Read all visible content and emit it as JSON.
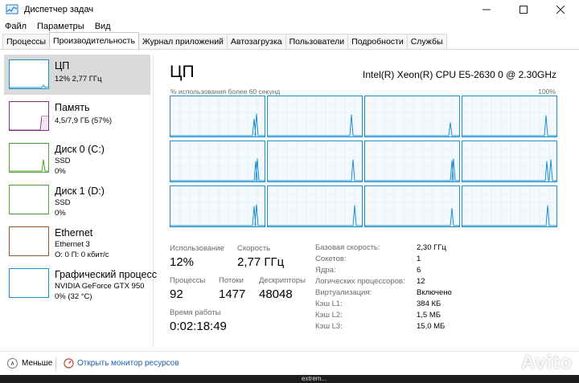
{
  "window": {
    "title": "Диспетчер задач"
  },
  "menu": [
    "Файл",
    "Параметры",
    "Вид"
  ],
  "tabs": [
    "Процессы",
    "Производительность",
    "Журнал приложений",
    "Автозагрузка",
    "Пользователи",
    "Подробности",
    "Службы"
  ],
  "active_tab": "Производительность",
  "sidebar": {
    "items": [
      {
        "name": "ЦП",
        "sub1": "12% 2,77 ГГц",
        "sub2": "",
        "color": "#1a8fd0",
        "selected": true
      },
      {
        "name": "Память",
        "sub1": "4,5/7,9 ГБ (57%)",
        "sub2": "",
        "color": "#8b2c8b",
        "selected": false
      },
      {
        "name": "Диск 0 (C:)",
        "sub1": "SSD",
        "sub2": "0%",
        "color": "#4da32b",
        "selected": false
      },
      {
        "name": "Диск 1 (D:)",
        "sub1": "SSD",
        "sub2": "0%",
        "color": "#4da32b",
        "selected": false
      },
      {
        "name": "Ethernet",
        "sub1": "Ethernet 3",
        "sub2": "О: 0 П: 0 кбит/с",
        "color": "#a0522d",
        "selected": false
      },
      {
        "name": "Графический процесс",
        "sub1": "NVIDIA GeForce GTX 950",
        "sub2": "0% (32 °C)",
        "color": "#1a8fd0",
        "selected": false
      }
    ]
  },
  "main": {
    "title": "ЦП",
    "cpu_model": "Intel(R) Xeon(R) CPU E5-2630 0 @ 2.30GHz",
    "graph_label": "% использования более 60 секунд",
    "graph_max": "100%",
    "cores": 12,
    "stats": {
      "usage_label": "Использование",
      "usage_value": "12%",
      "speed_label": "Скорость",
      "speed_value": "2,77 ГГц",
      "processes_label": "Процессы",
      "processes_value": "92",
      "threads_label": "Потоки",
      "threads_value": "1477",
      "handles_label": "Дескрипторы",
      "handles_value": "48048",
      "uptime_label": "Время работы",
      "uptime_value": "0:02:18:49"
    },
    "specs": [
      {
        "key": "Базовая скорость:",
        "value": "2,30 ГГц"
      },
      {
        "key": "Сокетов:",
        "value": "1"
      },
      {
        "key": "Ядра:",
        "value": "6"
      },
      {
        "key": "Логических процессоров:",
        "value": "12"
      },
      {
        "key": "Виртуализация:",
        "value": "Включено"
      },
      {
        "key": "Кэш L1:",
        "value": "384 КБ"
      },
      {
        "key": "Кэш L2:",
        "value": "1,5 МБ"
      },
      {
        "key": "Кэш L3:",
        "value": "15,0 МБ"
      }
    ]
  },
  "footer": {
    "less": "Меньше",
    "monitor": "Открыть монитор ресурсов"
  },
  "watermark": "Avito",
  "bottom_text": "extrem..."
}
